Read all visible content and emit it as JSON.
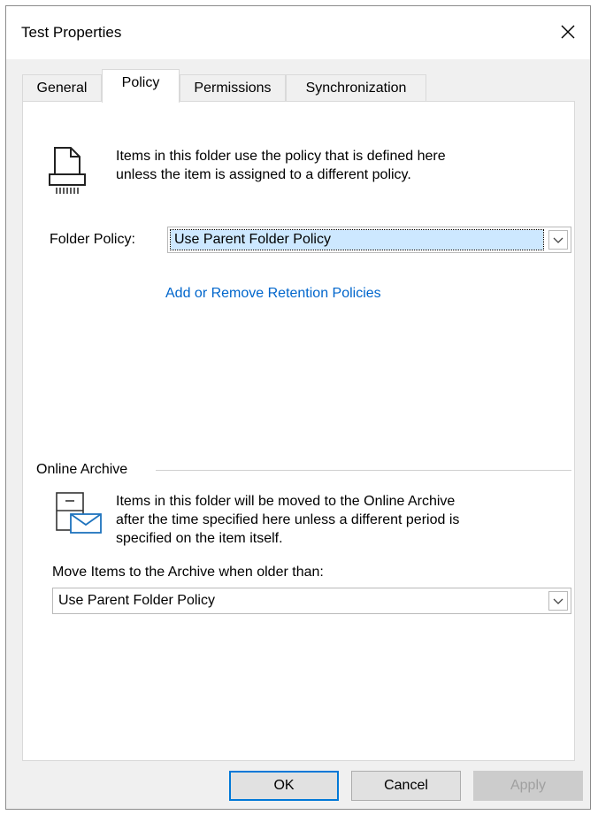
{
  "window": {
    "title": "Test Properties"
  },
  "tabs": [
    {
      "label": "General"
    },
    {
      "label": "Policy"
    },
    {
      "label": "Permissions"
    },
    {
      "label": "Synchronization"
    }
  ],
  "policy": {
    "info_line1": "Items in this folder use the policy that is defined here",
    "info_line2": "unless the item is assigned to a different policy.",
    "folder_policy_label": "Folder Policy:",
    "folder_policy_value": "Use Parent Folder Policy",
    "retention_link": "Add or Remove Retention Policies"
  },
  "archive": {
    "group_label": "Online Archive",
    "info_line1": "Items in this folder will be moved to the Online Archive",
    "info_line2": "after the time specified here unless a different period is",
    "info_line3": "specified on the item itself.",
    "move_label": "Move Items to the Archive when older than:",
    "move_value": "Use Parent Folder Policy"
  },
  "buttons": {
    "ok": "OK",
    "cancel": "Cancel",
    "apply": "Apply"
  },
  "colors": {
    "link": "#0066cc",
    "selection": "#cde8ff",
    "default_button_border": "#0078d7"
  },
  "icons": [
    "close-icon",
    "shredder-policy-icon",
    "archive-mail-icon",
    "chevron-down-icon"
  ]
}
